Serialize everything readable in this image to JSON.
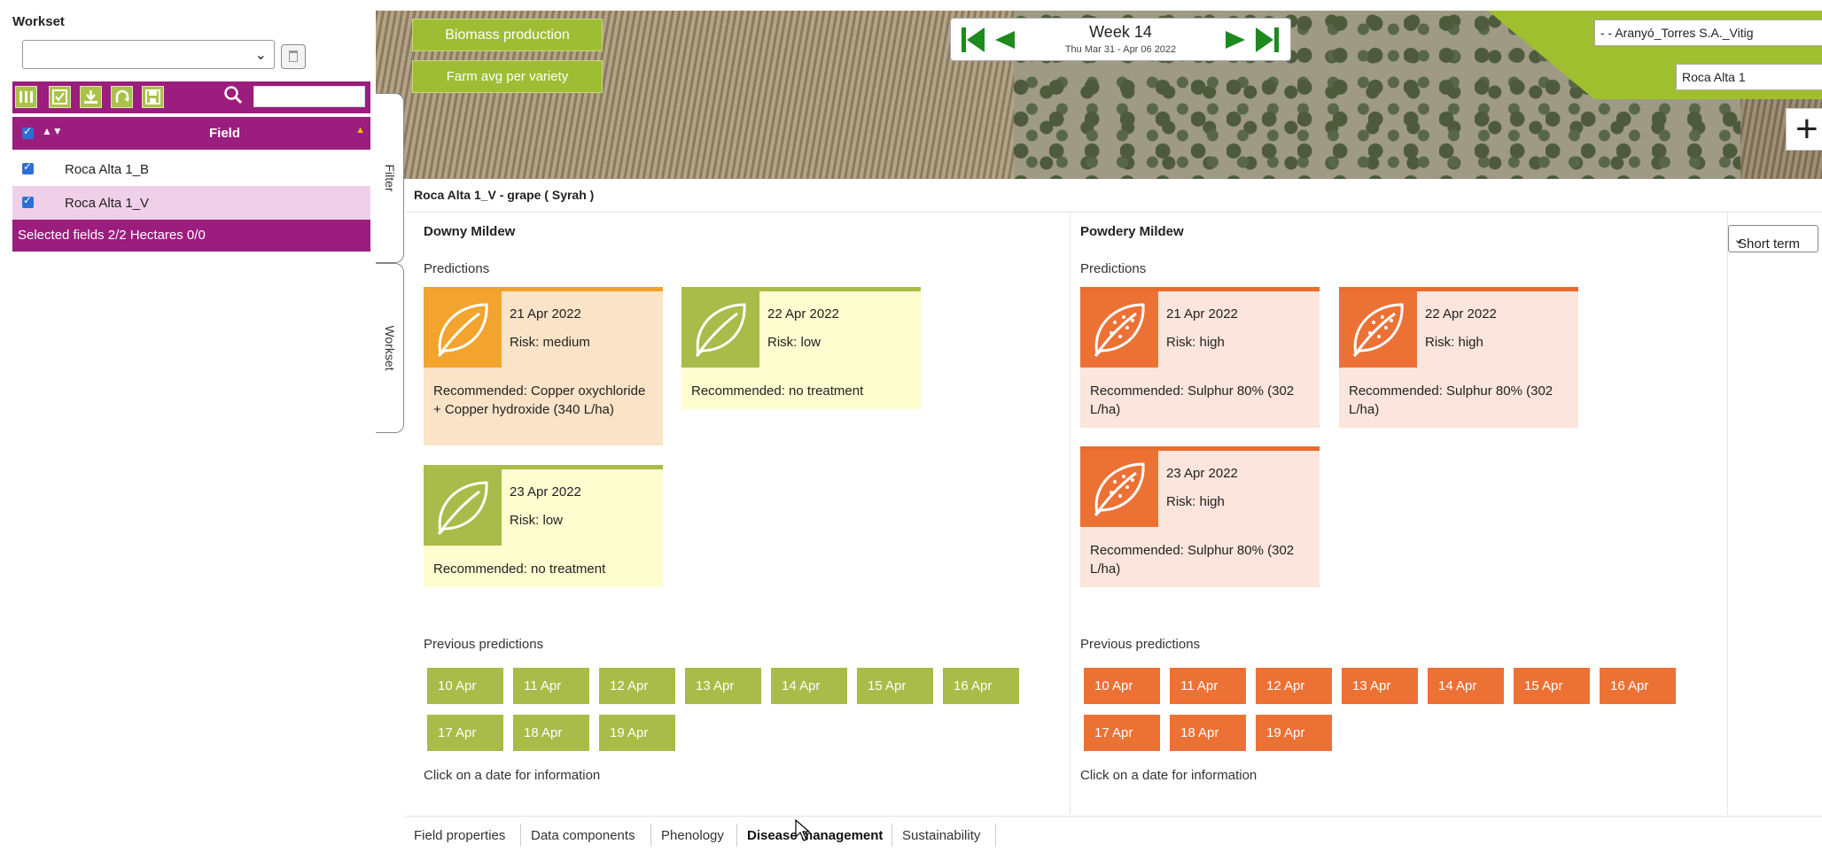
{
  "workset": {
    "title": "Workset",
    "select_value": "",
    "search_value": "",
    "column_header": "Field",
    "rows": [
      {
        "label": "Roca Alta 1_B",
        "checked": true,
        "highlight": false
      },
      {
        "label": "Roca Alta 1_V",
        "checked": true,
        "highlight": true
      }
    ],
    "footer": "Selected fields 2/2 Hectares 0/0"
  },
  "side_tabs": {
    "filter": "Filter",
    "workset": "Workset"
  },
  "map": {
    "buttons": {
      "biomass": "Biomass production",
      "farm_avg": "Farm avg per variety"
    },
    "week_nav": {
      "week": "Week 14",
      "date_range": "Thu Mar 31 - Apr 06 2022"
    },
    "farm_select": "- - Aranyó_Torres S.A._Vitig",
    "field_select": "Roca Alta 1",
    "zoom_label": "+"
  },
  "panel": {
    "title": "Roca Alta 1_V - grape ( Syrah )",
    "term_select": "Short term",
    "downy": {
      "title": "Downy Mildew",
      "predictions_label": "Predictions",
      "cards": [
        {
          "date": "21 Apr 2022",
          "risk": "Risk: medium",
          "rec": "Recommended: Copper oxychloride + Copper hydroxide (340 L/ha)",
          "level": "medium"
        },
        {
          "date": "22 Apr 2022",
          "risk": "Risk: low",
          "rec": "Recommended: no treatment",
          "level": "low"
        },
        {
          "date": "23 Apr 2022",
          "risk": "Risk: low",
          "rec": "Recommended: no treatment",
          "level": "low"
        }
      ],
      "previous_label": "Previous predictions",
      "previous_dates": [
        "10 Apr",
        "11 Apr",
        "12 Apr",
        "13 Apr",
        "14 Apr",
        "15 Apr",
        "16 Apr",
        "17 Apr",
        "18 Apr",
        "19 Apr"
      ],
      "hint": "Click on a date for information"
    },
    "powdery": {
      "title": "Powdery Mildew",
      "predictions_label": "Predictions",
      "cards": [
        {
          "date": "21 Apr 2022",
          "risk": "Risk: high",
          "rec": "Recommended: Sulphur 80% (302 L/ha)",
          "level": "high"
        },
        {
          "date": "22 Apr 2022",
          "risk": "Risk: high",
          "rec": "Recommended: Sulphur 80% (302 L/ha)",
          "level": "high"
        },
        {
          "date": "23 Apr 2022",
          "risk": "Risk: high",
          "rec": "Recommended: Sulphur 80% (302 L/ha)",
          "level": "high"
        }
      ],
      "previous_label": "Previous predictions",
      "previous_dates": [
        "10 Apr",
        "11 Apr",
        "12 Apr",
        "13 Apr",
        "14 Apr",
        "15 Apr",
        "16 Apr",
        "17 Apr",
        "18 Apr",
        "19 Apr"
      ],
      "hint": "Click on a date for information"
    }
  },
  "bottom_tabs": [
    {
      "label": "Field properties",
      "active": false
    },
    {
      "label": "Data components",
      "active": false
    },
    {
      "label": "Phenology",
      "active": false
    },
    {
      "label": "Disease management",
      "active": true
    },
    {
      "label": "Sustainability",
      "active": false
    }
  ],
  "colors": {
    "purple": "#9b1d7e",
    "green": "#a9bb48",
    "orange": "#ec7135",
    "amber": "#f2a42e"
  }
}
